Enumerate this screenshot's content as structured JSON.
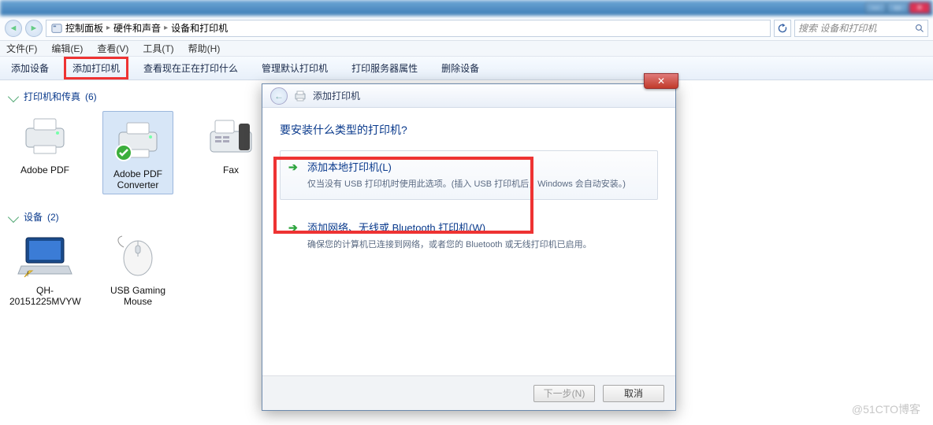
{
  "titlebar": {},
  "address": {
    "seg1": "控制面板",
    "seg2": "硬件和声音",
    "seg3": "设备和打印机",
    "sep": "▸",
    "refresh_btn_icon": "refresh-icon"
  },
  "search": {
    "placeholder": "搜索 设备和打印机"
  },
  "menubar": {
    "file": "文件(F)",
    "edit": "编辑(E)",
    "view": "查看(V)",
    "tools": "工具(T)",
    "help": "帮助(H)"
  },
  "cmdbar": {
    "add_device": "添加设备",
    "add_printer": "添加打印机",
    "see_printing": "查看现在正在打印什么",
    "manage_default": "管理默认打印机",
    "print_server_props": "打印服务器属性",
    "delete_device": "删除设备"
  },
  "groups": {
    "printers": {
      "header": "打印机和传真",
      "count": "(6)"
    },
    "devices": {
      "header": "设备",
      "count": "(2)"
    }
  },
  "printers": {
    "items": [
      {
        "label": "Adobe PDF",
        "icon": "printer-icon"
      },
      {
        "label": "Adobe PDF Converter",
        "icon": "printer-default-icon",
        "selected": true
      },
      {
        "label": "Fax",
        "icon": "fax-icon"
      }
    ]
  },
  "devices": {
    "items": [
      {
        "label": "QH-20151225MVYW",
        "icon": "laptop-icon"
      },
      {
        "label": "USB Gaming Mouse",
        "icon": "mouse-icon"
      }
    ]
  },
  "dialog": {
    "title": "添加打印机",
    "heading": "要安装什么类型的打印机?",
    "option_local_title": "添加本地打印机(L)",
    "option_local_desc": "仅当没有 USB 打印机时使用此选项。(插入 USB 打印机后，Windows 会自动安装。)",
    "option_network_title": "添加网络、无线或 Bluetooth 打印机(W)",
    "option_network_desc": "确保您的计算机已连接到网络，或者您的 Bluetooth 或无线打印机已启用。",
    "next_btn": "下一步(N)",
    "cancel_btn": "取消"
  },
  "watermark": "@51CTO博客"
}
